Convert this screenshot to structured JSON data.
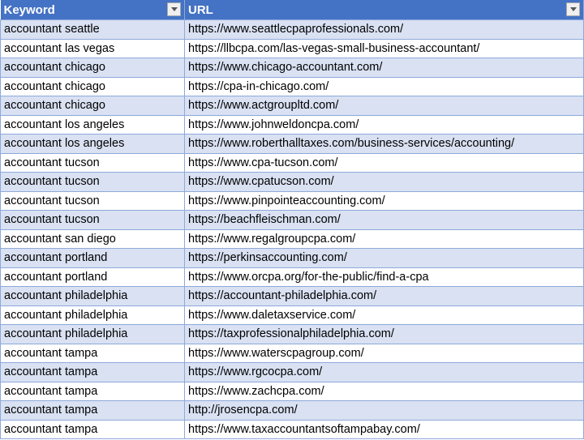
{
  "columns": [
    {
      "label": "Keyword"
    },
    {
      "label": "URL"
    }
  ],
  "rows": [
    {
      "keyword": "accountant seattle",
      "url": "https://www.seattlecpaprofessionals.com/"
    },
    {
      "keyword": "accountant las vegas",
      "url": "https://llbcpa.com/las-vegas-small-business-accountant/"
    },
    {
      "keyword": "accountant chicago",
      "url": "https://www.chicago-accountant.com/"
    },
    {
      "keyword": "accountant chicago",
      "url": "https://cpa-in-chicago.com/"
    },
    {
      "keyword": "accountant chicago",
      "url": "https://www.actgroupltd.com/"
    },
    {
      "keyword": "accountant los angeles",
      "url": "https://www.johnweldoncpa.com/"
    },
    {
      "keyword": "accountant los angeles",
      "url": "https://www.roberthalltaxes.com/business-services/accounting/"
    },
    {
      "keyword": "accountant tucson",
      "url": "https://www.cpa-tucson.com/"
    },
    {
      "keyword": "accountant tucson",
      "url": "https://www.cpatucson.com/"
    },
    {
      "keyword": "accountant tucson",
      "url": "https://www.pinpointeaccounting.com/"
    },
    {
      "keyword": "accountant tucson",
      "url": "https://beachfleischman.com/"
    },
    {
      "keyword": "accountant san diego",
      "url": "https://www.regalgroupcpa.com/"
    },
    {
      "keyword": "accountant portland",
      "url": "https://perkinsaccounting.com/"
    },
    {
      "keyword": "accountant portland",
      "url": "https://www.orcpa.org/for-the-public/find-a-cpa"
    },
    {
      "keyword": "accountant philadelphia",
      "url": "https://accountant-philadelphia.com/"
    },
    {
      "keyword": "accountant philadelphia",
      "url": "https://www.daletaxservice.com/"
    },
    {
      "keyword": "accountant philadelphia",
      "url": "https://taxprofessionalphiladelphia.com/"
    },
    {
      "keyword": "accountant tampa",
      "url": "https://www.waterscpagroup.com/"
    },
    {
      "keyword": "accountant tampa",
      "url": "https://www.rgcocpa.com/"
    },
    {
      "keyword": "accountant tampa",
      "url": "https://www.zachcpa.com/"
    },
    {
      "keyword": "accountant tampa",
      "url": "http://jrosencpa.com/"
    },
    {
      "keyword": "accountant tampa",
      "url": "https://www.taxaccountantsoftampabay.com/"
    }
  ]
}
